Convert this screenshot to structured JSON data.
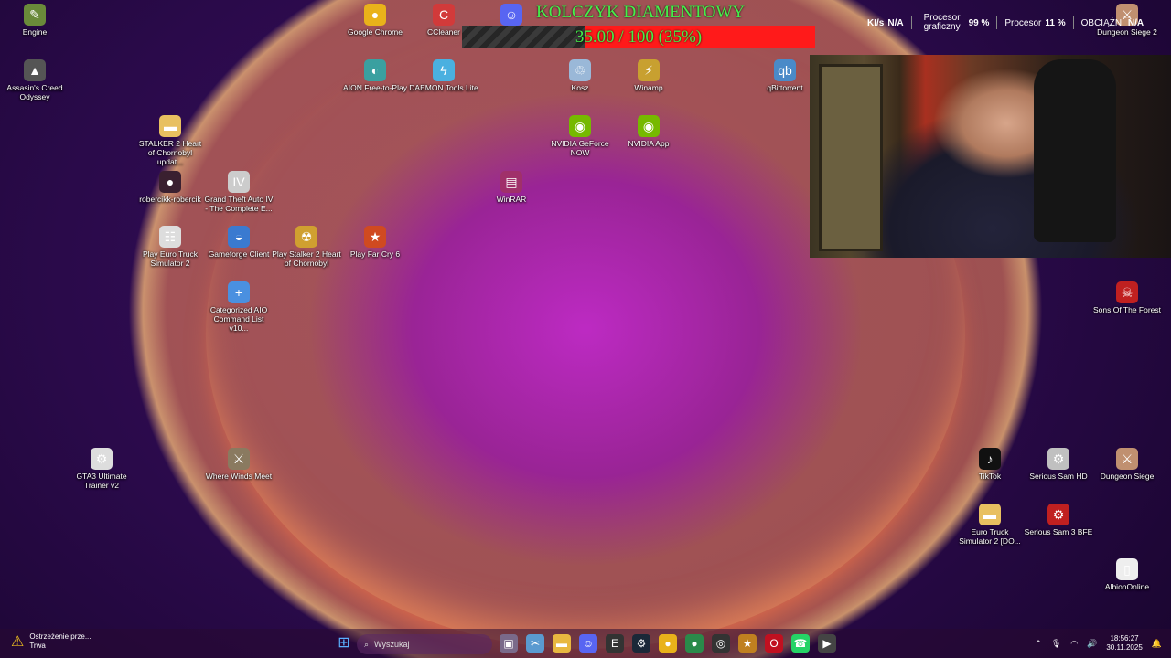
{
  "desktop_icons": [
    {
      "label": "Engine",
      "icon": "engine-icon",
      "color": "#6a8a3a",
      "glyph": "✎"
    },
    {
      "label": "Assasin's Creed Odyssey",
      "icon": "assassins-creed-icon",
      "color": "#555555",
      "glyph": "▲"
    },
    {
      "label": "Google Chrome",
      "icon": "chrome-icon",
      "color": "#e9b21a",
      "glyph": "●"
    },
    {
      "label": "CCleaner",
      "icon": "ccleaner-icon",
      "color": "#d23a3a",
      "glyph": "C"
    },
    {
      "label": "AION Free-to-Play",
      "icon": "aion-icon",
      "color": "#3aa0a0",
      "glyph": "◐"
    },
    {
      "label": "DAEMON Tools Lite",
      "icon": "daemon-tools-icon",
      "color": "#4ab0e0",
      "glyph": "ϟ"
    },
    {
      "label": "Discord",
      "icon": "discord-icon",
      "color": "#5865f2",
      "glyph": "☺"
    },
    {
      "label": "Kosz",
      "icon": "recycle-bin-icon",
      "color": "#9ab8d8",
      "glyph": "♲"
    },
    {
      "label": "Winamp",
      "icon": "winamp-icon",
      "color": "#c8a030",
      "glyph": "⚡"
    },
    {
      "label": "qBittorrent",
      "icon": "qbittorrent-icon",
      "color": "#4a8ac8",
      "glyph": "qb"
    },
    {
      "label": "STALKER 2 Heart of Chornobyl updat...",
      "icon": "folder-icon",
      "color": "#e8c060",
      "glyph": "▬"
    },
    {
      "label": "NVIDIA GeForce NOW",
      "icon": "nvidia-geforce-now-icon",
      "color": "#76b900",
      "glyph": "◉"
    },
    {
      "label": "NVIDIA App",
      "icon": "nvidia-app-icon",
      "color": "#76b900",
      "glyph": "◉"
    },
    {
      "label": "robercikk-robercik",
      "icon": "user-shortcut-icon",
      "color": "#3a2030",
      "glyph": "●"
    },
    {
      "label": "Grand Theft Auto IV - The Complete E...",
      "icon": "gta4-icon",
      "color": "#cccccc",
      "glyph": "IV"
    },
    {
      "label": "WinRAR",
      "icon": "winrar-icon",
      "color": "#a0306a",
      "glyph": "▤"
    },
    {
      "label": "Play Euro Truck Simulator 2",
      "icon": "euro-truck-icon",
      "color": "#dddddd",
      "glyph": "☷"
    },
    {
      "label": "Gameforge Client",
      "icon": "gameforge-icon",
      "color": "#3a7ad0",
      "glyph": "◒"
    },
    {
      "label": "Play Stalker 2 Heart of Chornobyl",
      "icon": "stalker2-icon",
      "color": "#d0a030",
      "glyph": "☢"
    },
    {
      "label": "Play Far Cry 6",
      "icon": "far-cry-6-icon",
      "color": "#d04a20",
      "glyph": "★"
    },
    {
      "label": "Categorized AIO Command List v10...",
      "icon": "document-icon",
      "color": "#4a90e0",
      "glyph": "+"
    },
    {
      "label": "Sons Of The Forest",
      "icon": "sons-of-the-forest-icon",
      "color": "#c02020",
      "glyph": "☠"
    },
    {
      "label": "GTA3 Ultimate Trainer v2",
      "icon": "trainer-icon",
      "color": "#dddddd",
      "glyph": "⚙"
    },
    {
      "label": "Where Winds Meet",
      "icon": "where-winds-meet-icon",
      "color": "#8a7a60",
      "glyph": "⚔"
    },
    {
      "label": "TikTok",
      "icon": "tiktok-icon",
      "color": "#111111",
      "glyph": "♪"
    },
    {
      "label": "Serious Sam HD",
      "icon": "serious-sam-hd-icon",
      "color": "#c0c0c0",
      "glyph": "⚙"
    },
    {
      "label": "Dungeon Siege",
      "icon": "dungeon-siege-icon",
      "color": "#c09070",
      "glyph": "⚔"
    },
    {
      "label": "Euro Truck Simulator 2 [DO...",
      "icon": "folder-icon",
      "color": "#e8c060",
      "glyph": "▬"
    },
    {
      "label": "Serious Sam 3 BFE",
      "icon": "serious-sam-3-icon",
      "color": "#c02020",
      "glyph": "⚙"
    },
    {
      "label": "AlbionOnline",
      "icon": "file-icon",
      "color": "#eeeeee",
      "glyph": "▯"
    },
    {
      "label": "Dungeon Siege 2",
      "icon": "dungeon-siege-2-icon",
      "color": "#c09070",
      "glyph": "⚔"
    }
  ],
  "overlay": {
    "donation_title": "KOLCZYK DIAMENTOWY",
    "donation_progress_text": "35.00 / 100 (35%)",
    "donation_progress": 0.35,
    "title_color": "#45f04a",
    "bar_color": "#ff1a1a"
  },
  "hw_stats": {
    "net_label": "KI/s",
    "net_value": "N/A",
    "gpu_label": "Procesor graficzny",
    "gpu_value": "99 %",
    "cpu_label": "Procesor",
    "cpu_value": "11 %",
    "ram_label": "OBCIĄŻN.",
    "ram_value": "N/A"
  },
  "taskbar": {
    "warning_title": "Ostrzeżenie prze...",
    "warning_subtitle": "Trwa",
    "search_placeholder": "Wyszukaj",
    "time": "18:56:27",
    "date": "30.11.2025",
    "pinned": [
      {
        "name": "task-view-icon",
        "color": "#7a6a8a",
        "glyph": "▣"
      },
      {
        "name": "snipping-icon",
        "color": "#5a9ad0",
        "glyph": "✂"
      },
      {
        "name": "file-explorer-icon",
        "color": "#e8b840",
        "glyph": "▬"
      },
      {
        "name": "discord-icon",
        "color": "#5865f2",
        "glyph": "☺"
      },
      {
        "name": "epic-games-icon",
        "color": "#333333",
        "glyph": "E"
      },
      {
        "name": "steam-icon",
        "color": "#1b2838",
        "glyph": "⚙"
      },
      {
        "name": "chrome-icon",
        "color": "#e9b21a",
        "glyph": "●"
      },
      {
        "name": "chrome-icon",
        "color": "#2a8a4a",
        "glyph": "●"
      },
      {
        "name": "obs-icon",
        "color": "#333333",
        "glyph": "◎"
      },
      {
        "name": "game-icon",
        "color": "#c08020",
        "glyph": "★"
      },
      {
        "name": "opera-icon",
        "color": "#c01020",
        "glyph": "O"
      },
      {
        "name": "whatsapp-icon",
        "color": "#25d366",
        "glyph": "☎"
      },
      {
        "name": "media-player-icon",
        "color": "#444444",
        "glyph": "▶"
      }
    ]
  }
}
